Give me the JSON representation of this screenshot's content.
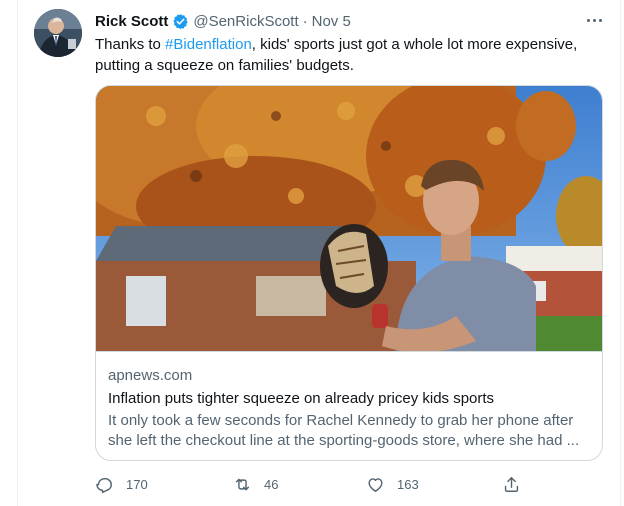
{
  "tweet": {
    "author_name": "Rick Scott",
    "handle": "@SenRickScott",
    "separator": "·",
    "date": "Nov 5",
    "text_before": "Thanks to ",
    "hashtag": "#Bidenflation",
    "text_after": ", kids' sports just got a whole lot more expensive, putting a squeeze on families' budgets."
  },
  "card": {
    "domain": "apnews.com",
    "title": "Inflation puts tighter squeeze on already pricey kids sports",
    "description": "It only took a few seconds for Rachel Kennedy to grab her phone after she left the checkout line at the sporting-goods store, where she had ..."
  },
  "actions": {
    "replies": "170",
    "retweets": "46",
    "likes": "163"
  },
  "icons": {
    "verified": "verified-badge-icon",
    "more": "more-horizontal-icon",
    "reply": "reply-icon",
    "retweet": "retweet-icon",
    "like": "heart-icon",
    "share": "share-icon"
  },
  "colors": {
    "accent": "#1d9bf0",
    "secondary_text": "#536471",
    "border": "#cfd9de"
  }
}
